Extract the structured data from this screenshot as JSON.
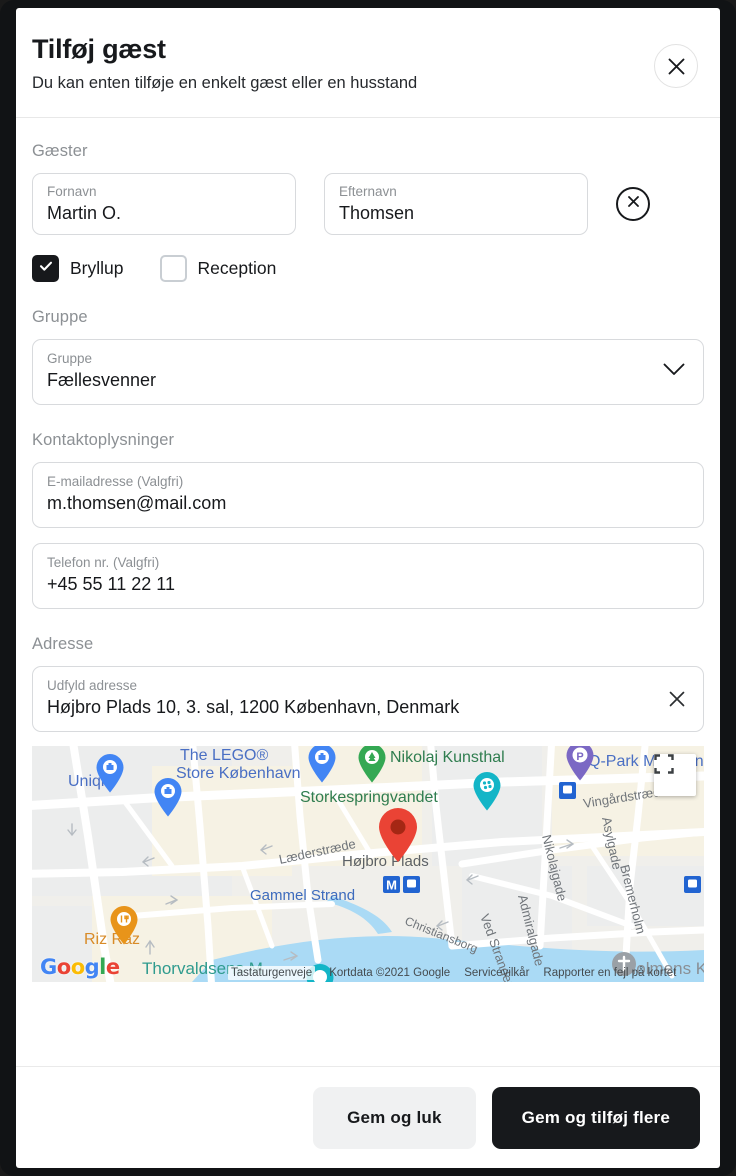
{
  "header": {
    "title": "Tilføj gæst",
    "subtitle": "Du kan enten tilføje en enkelt gæst eller en husstand",
    "close_icon": "close-icon"
  },
  "sections": {
    "guests_label": "Gæster",
    "group_label": "Gruppe",
    "contact_label": "Kontaktoplysninger",
    "address_label": "Adresse"
  },
  "guest": {
    "firstname_label": "Fornavn",
    "firstname_value": "Martin O.",
    "lastname_label": "Efternavn",
    "lastname_value": "Thomsen",
    "remove_icon": "close-circle-icon",
    "events": [
      {
        "label": "Bryllup",
        "checked": true
      },
      {
        "label": "Reception",
        "checked": false
      }
    ]
  },
  "group": {
    "field_label": "Gruppe",
    "value": "Fællesvenner",
    "chevron_icon": "chevron-down-icon"
  },
  "contact": {
    "email_label": "E-mailadresse (Valgfri)",
    "email_value": "m.thomsen@mail.com",
    "phone_label": "Telefon nr. (Valgfri)",
    "phone_value": "+45 55 11 22 11"
  },
  "address": {
    "field_label": "Udfyld adresse",
    "value": "Højbro Plads 10, 3. sal, 1200 København, Denmark",
    "clear_icon": "close-icon"
  },
  "map": {
    "fullscreen_icon": "fullscreen-icon",
    "marker_icon": "map-pin-icon",
    "google_logo": [
      "G",
      "o",
      "o",
      "g",
      "l",
      "e"
    ],
    "attribution": {
      "keyboard": "Tastaturgenveje",
      "data": "Kortdata ©2021 Google",
      "terms": "Servicevilkår",
      "report": "Rapporter en fejl på kortet"
    },
    "labels": {
      "lego": "The LEGO®",
      "lego2": "Store København",
      "uniqlo": "Uniqlo",
      "nikolaj": "Nikolaj Kunsthal",
      "storke": "Storkespringvandet",
      "qpark": "Q-Park Magasin",
      "hojbro": "Højbro Plads",
      "laederstraede": "Læderstræde",
      "gammel": "Gammel Strand",
      "vingaard": "Vingårdstræde",
      "nikolajgade": "Nikolajgade",
      "asylgade": "Asylgade",
      "bremerholm": "Bremerholm",
      "admiralgade": "Admiralgade",
      "christiansborg": "Christiansborg",
      "vedstranden": "Ved Stranden",
      "rizraz": "Riz Raz",
      "thorvaldsens": "Thorvaldsens M",
      "holmens": "Holmens K"
    }
  },
  "footer": {
    "secondary_label": "Gem og luk",
    "primary_label": "Gem og tilføj flere"
  }
}
